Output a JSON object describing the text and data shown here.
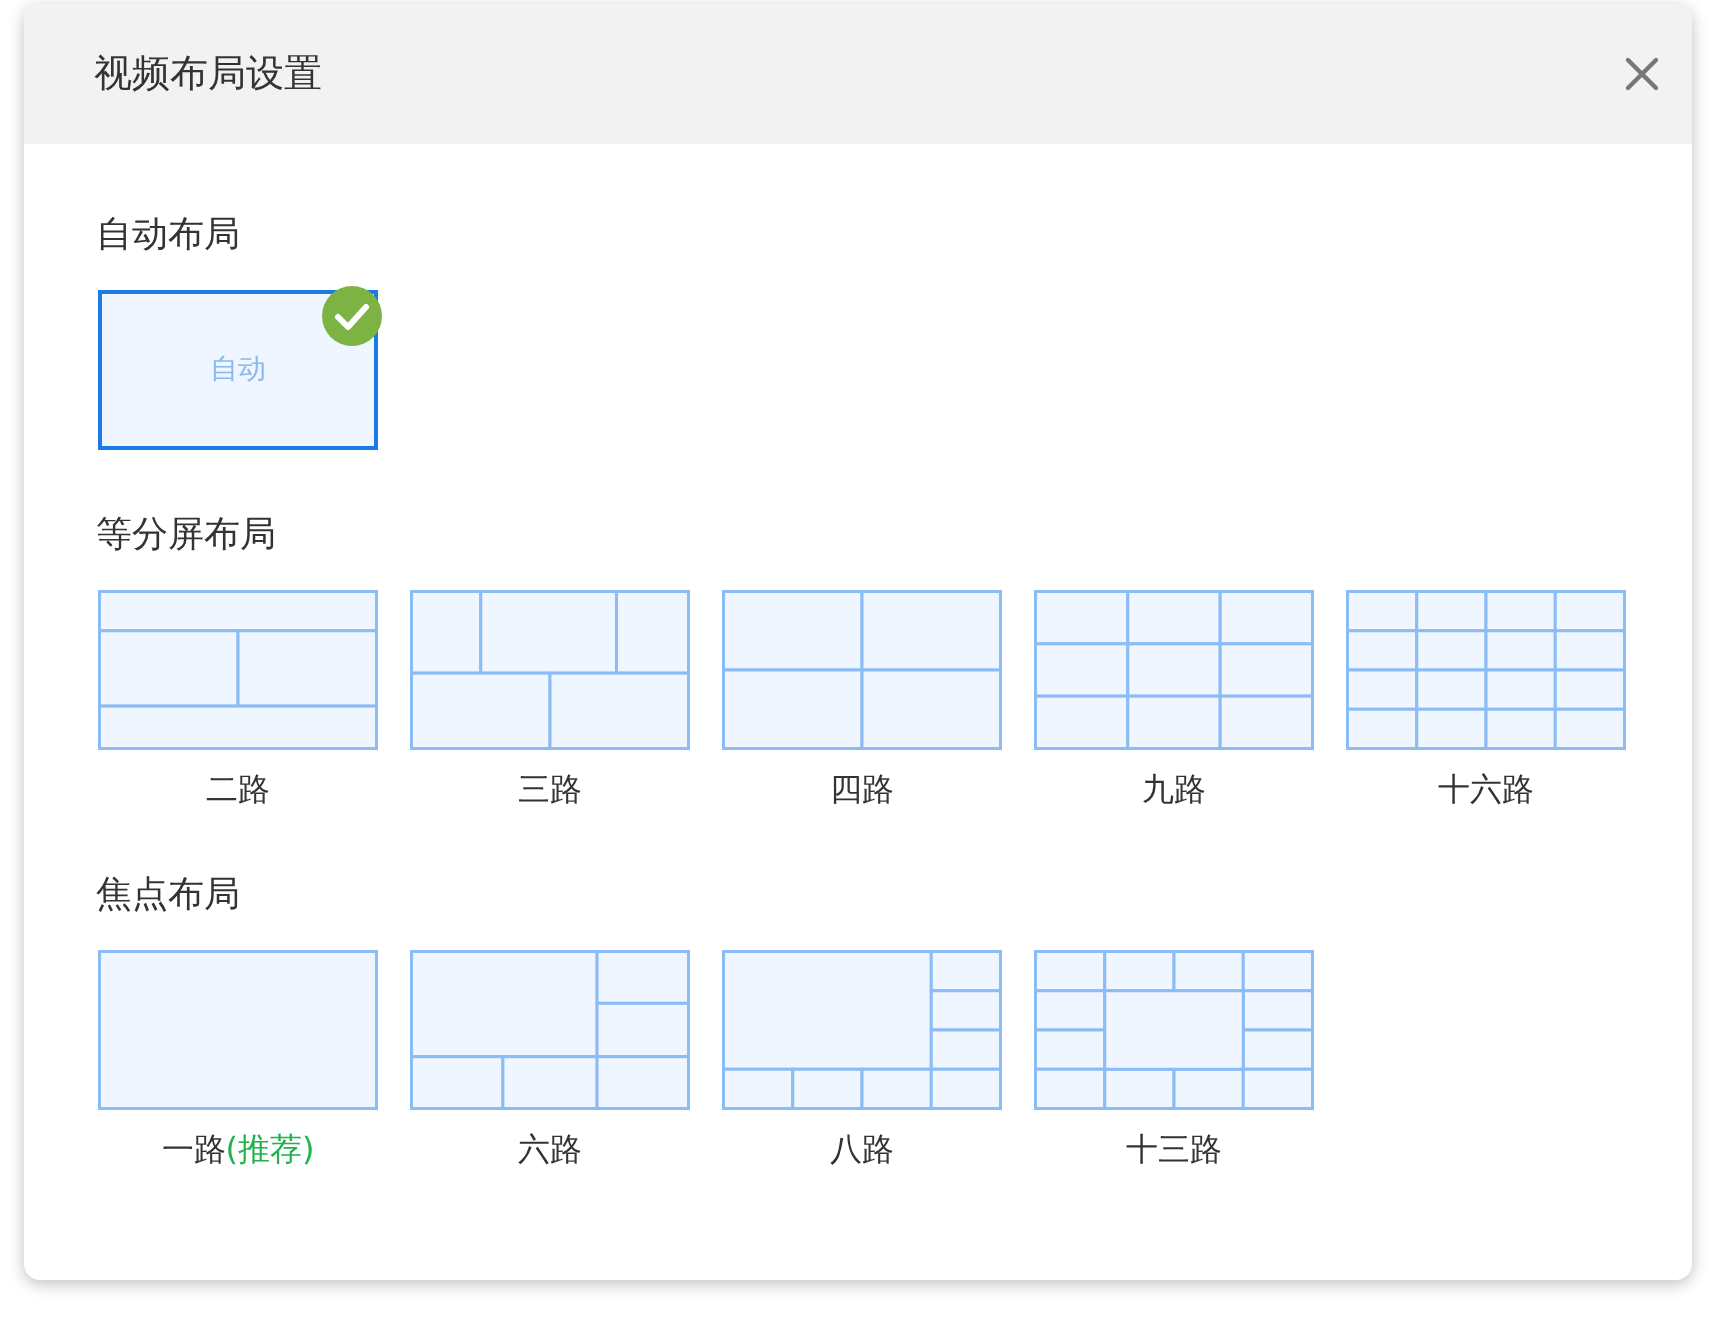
{
  "dialog": {
    "title": "视频布局设置"
  },
  "sections": [
    {
      "heading": "自动布局",
      "layouts": [
        {
          "kind": "auto",
          "text": "自动",
          "selected": true
        }
      ]
    },
    {
      "heading": "等分屏布局",
      "layouts": [
        {
          "kind": "two",
          "label": "二路",
          "selected": false
        },
        {
          "kind": "three",
          "label": "三路",
          "selected": false
        },
        {
          "kind": "four",
          "label": "四路",
          "selected": false
        },
        {
          "kind": "nine",
          "label": "九路",
          "selected": false
        },
        {
          "kind": "sixteen",
          "label": "十六路",
          "selected": false
        }
      ]
    },
    {
      "heading": "焦点布局",
      "layouts": [
        {
          "kind": "one",
          "label": "一路",
          "tag": "(推荐)",
          "selected": false
        },
        {
          "kind": "six",
          "label": "六路",
          "selected": false
        },
        {
          "kind": "eight",
          "label": "八路",
          "selected": false
        },
        {
          "kind": "thirteen",
          "label": "十三路",
          "selected": false
        }
      ]
    }
  ]
}
